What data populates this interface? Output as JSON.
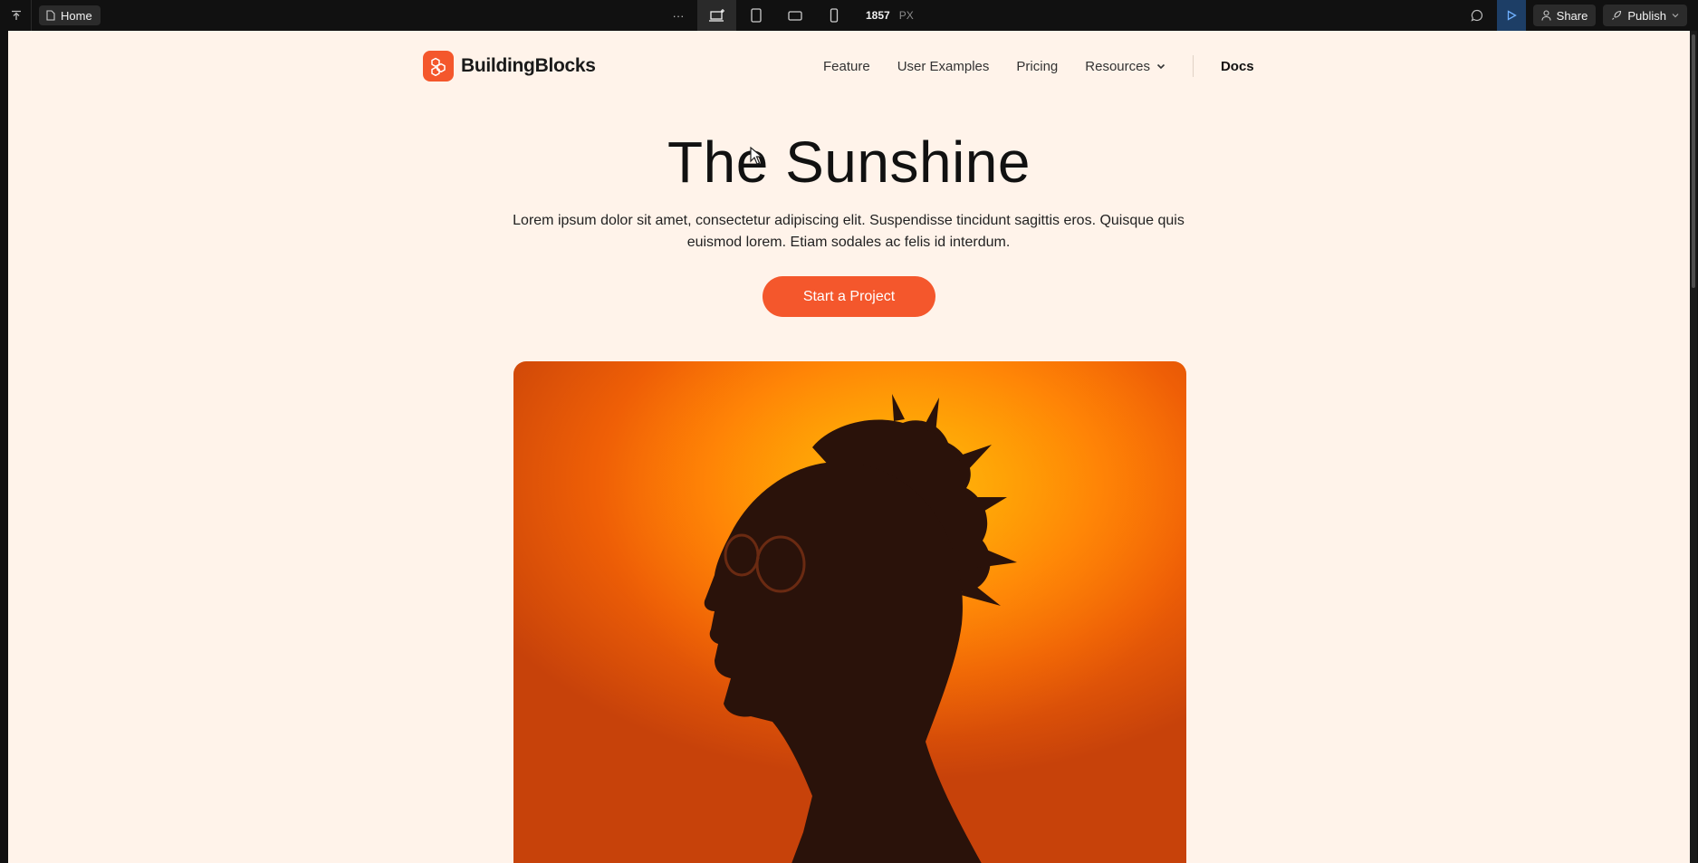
{
  "editor": {
    "page_tab": "Home",
    "more_label": "···",
    "width_value": "1857",
    "width_unit": "PX",
    "share_label": "Share",
    "publish_label": "Publish",
    "accent": "#1d3e66"
  },
  "site": {
    "brand": "BuildingBlocks",
    "brand_color": "#f4572c",
    "background": "#fff3ea",
    "nav": {
      "items": [
        "Feature",
        "User Examples",
        "Pricing"
      ],
      "resources": "Resources",
      "docs": "Docs"
    },
    "hero": {
      "title": "The Sunshine",
      "body": "Lorem ipsum dolor sit amet, consectetur adipiscing elit. Suspendisse tincidunt sagittis eros. Quisque quis euismod lorem. Etiam sodales ac felis id interdum.",
      "cta": "Start a Project"
    }
  }
}
